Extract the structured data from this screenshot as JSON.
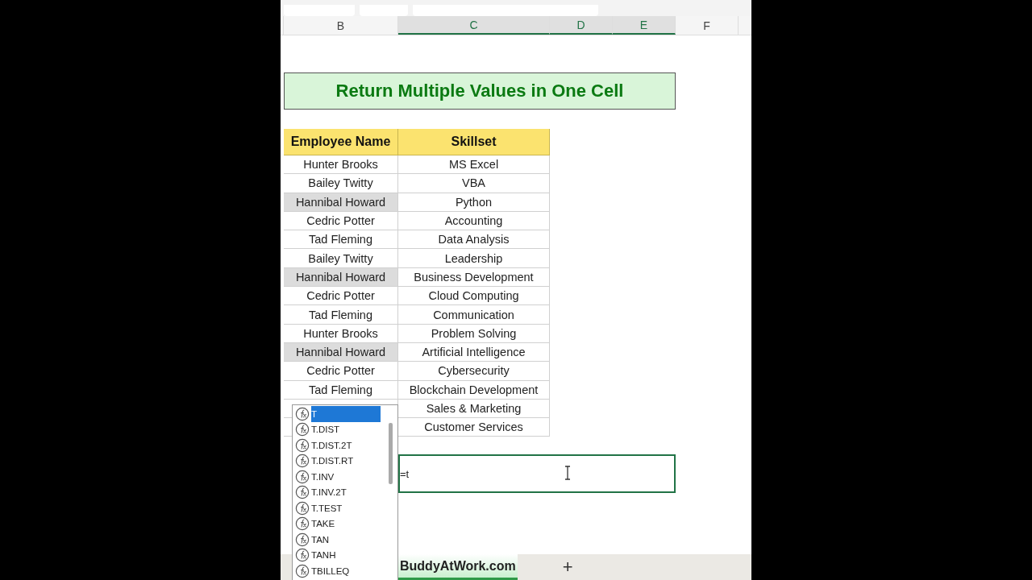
{
  "columns": [
    {
      "label": "B",
      "selected": false
    },
    {
      "label": "C",
      "selected": true
    },
    {
      "label": "D",
      "selected": true
    },
    {
      "label": "E",
      "selected": true
    },
    {
      "label": "F",
      "selected": false
    }
  ],
  "title": "Return Multiple Values in One Cell",
  "table": {
    "columns": [
      "Employee Name",
      "Skillset"
    ],
    "rows": [
      {
        "name": "Hunter Brooks",
        "skill": "MS Excel",
        "highlighted": false
      },
      {
        "name": "Bailey Twitty",
        "skill": "VBA",
        "highlighted": false
      },
      {
        "name": "Hannibal Howard",
        "skill": "Python",
        "highlighted": true
      },
      {
        "name": "Cedric Potter",
        "skill": "Accounting",
        "highlighted": false
      },
      {
        "name": "Tad Fleming",
        "skill": "Data Analysis",
        "highlighted": false
      },
      {
        "name": "Bailey Twitty",
        "skill": "Leadership",
        "highlighted": false
      },
      {
        "name": "Hannibal Howard",
        "skill": "Business Development",
        "highlighted": true
      },
      {
        "name": "Cedric Potter",
        "skill": "Cloud Computing",
        "highlighted": false
      },
      {
        "name": "Tad Fleming",
        "skill": "Communication",
        "highlighted": false
      },
      {
        "name": "Hunter Brooks",
        "skill": "Problem Solving",
        "highlighted": false
      },
      {
        "name": "Hannibal Howard",
        "skill": "Artificial Intelligence",
        "highlighted": true
      },
      {
        "name": "Cedric Potter",
        "skill": "Cybersecurity",
        "highlighted": false
      },
      {
        "name": "Tad Fleming",
        "skill": "Blockchain Development",
        "highlighted": false
      },
      {
        "skill": "Sales & Marketing",
        "highlighted": false
      },
      {
        "skill": "Customer Services",
        "highlighted": false
      }
    ]
  },
  "formula_cell": {
    "value": "=t"
  },
  "autocomplete": [
    {
      "label": "T",
      "selected": true
    },
    {
      "label": "T.DIST",
      "selected": false
    },
    {
      "label": "T.DIST.2T",
      "selected": false
    },
    {
      "label": "T.DIST.RT",
      "selected": false
    },
    {
      "label": "T.INV",
      "selected": false
    },
    {
      "label": "T.INV.2T",
      "selected": false
    },
    {
      "label": "T.TEST",
      "selected": false
    },
    {
      "label": "TAKE",
      "selected": false
    },
    {
      "label": "TAN",
      "selected": false
    },
    {
      "label": "TANH",
      "selected": false
    },
    {
      "label": "TBILLEQ",
      "selected": false
    }
  ],
  "sheet_tabs": [
    {
      "label": "BuddyAtWork.com",
      "selected": true
    }
  ],
  "add_sheet": "+"
}
